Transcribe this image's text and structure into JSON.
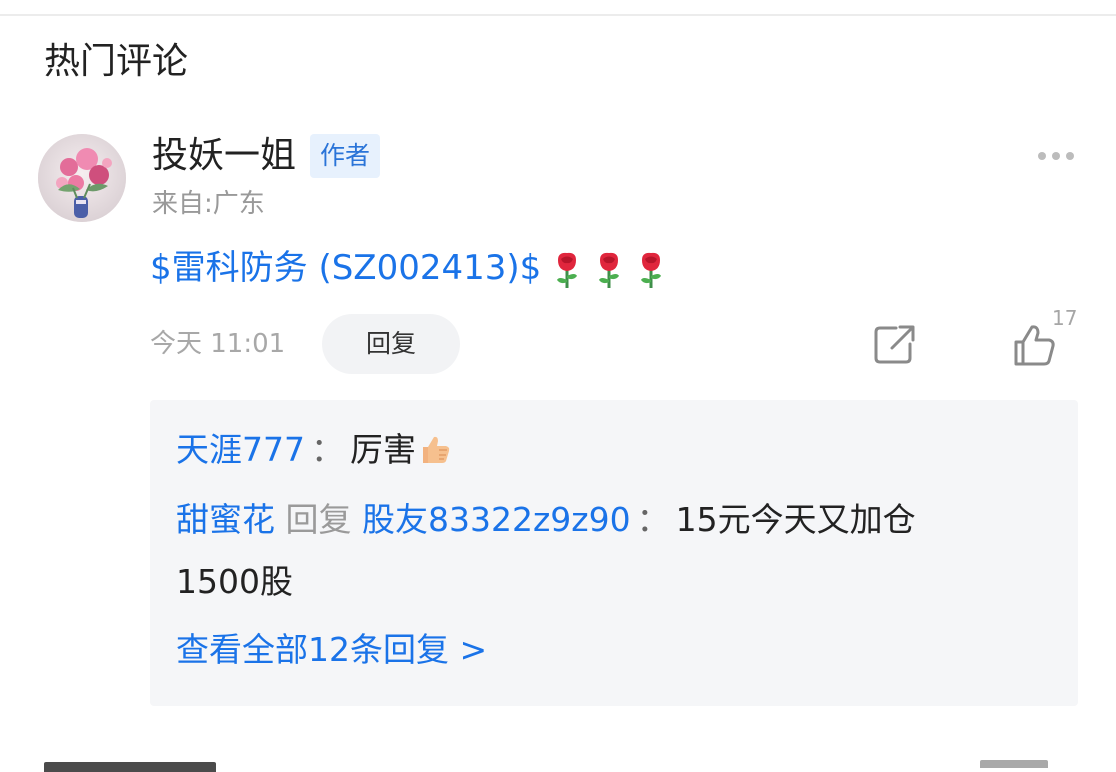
{
  "section": {
    "title": "热门评论"
  },
  "comment": {
    "author_name": "投妖一姐",
    "author_badge": "作者",
    "location": "来自:广东",
    "stock_link": "$雷科防务 (SZ002413)$",
    "rose_count": 3,
    "timestamp": "今天 11:01",
    "reply_label": "回复",
    "like_count": "17"
  },
  "replies": [
    {
      "user": "天涯777",
      "separator": "：",
      "text": "厉害"
    },
    {
      "user": "甜蜜花",
      "reply_word": "回复",
      "target": "股友83322z9z90",
      "separator": "：",
      "text_line1": "15元今天又加仓",
      "text_line2": "1500股"
    }
  ],
  "view_all": "查看全部12条回复 >",
  "colors": {
    "link": "#1a73e8",
    "badge_bg": "#e7f1fd",
    "badge_text": "#2a74d8",
    "reply_box_bg": "#f5f6f8",
    "muted": "#999999"
  },
  "icons": {
    "more": "more-dots-icon",
    "share": "share-icon",
    "like": "thumb-up-icon",
    "rose": "rose-icon",
    "thumb_emoji": "thumbs-up-emoji-icon"
  }
}
